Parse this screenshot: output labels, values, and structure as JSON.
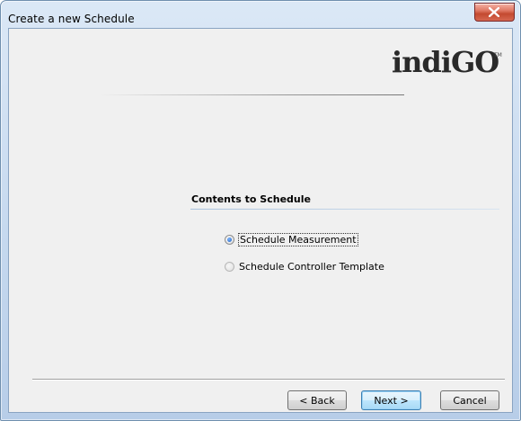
{
  "window": {
    "title": "Create a new Schedule",
    "close_glyph": "x"
  },
  "logo": {
    "text": "indiGO",
    "tm": "TM"
  },
  "section": {
    "title": "Contents to Schedule"
  },
  "options": [
    {
      "label": "Schedule Measurement",
      "selected": true
    },
    {
      "label": "Schedule Controller Template",
      "selected": false
    }
  ],
  "buttons": {
    "back": "< Back",
    "next": "Next >",
    "cancel": "Cancel"
  },
  "colors": {
    "accent": "#3c7fb1",
    "close": "#c44a30",
    "radio_selected": "#1d5fbf"
  }
}
